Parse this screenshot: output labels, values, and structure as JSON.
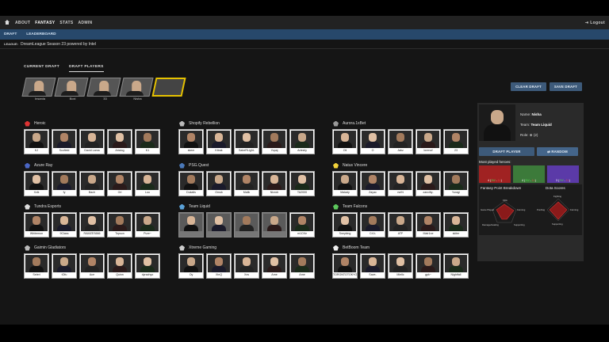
{
  "topnav": {
    "items": [
      "ABOUT",
      "FANTASY",
      "STATS",
      "ADMIN"
    ],
    "active": "FANTASY",
    "logout": "Logout"
  },
  "subnav": {
    "items": [
      "DRAFT",
      "LEADERBOARD"
    ]
  },
  "league": {
    "label": "LEAGUE:",
    "value": "DreamLeague Season 23 powered by Intel"
  },
  "tabs": [
    "CURRENT DRAFT",
    "DRAFT PLAYERS"
  ],
  "draft_slots": [
    "Insania",
    "Boxi",
    "33",
    "Nisha",
    ""
  ],
  "actions": {
    "clear": "CLEAR DRAFT",
    "save": "SAVE DRAFT"
  },
  "teams": [
    {
      "name": "Heroic",
      "color": "#d33",
      "players": [
        "KJ",
        "Scofield",
        "David Lama",
        "Arialog",
        "K1"
      ]
    },
    {
      "name": "Shopify Rebellion",
      "color": "#bbb",
      "players": [
        "skem",
        "Kitrak",
        "SabeRLight-",
        "Yopaj",
        "Artesiiy"
      ]
    },
    {
      "name": "Aurora.1xBet",
      "color": "#999",
      "players": [
        "Oli",
        "O",
        "Jabz",
        "lorenof",
        "23"
      ]
    },
    {
      "name": "Azure Ray",
      "color": "#4a66c4",
      "players": [
        "Xxlk",
        "fy",
        "Bach",
        "Ori",
        "Lou"
      ]
    },
    {
      "name": "PSG.Quest",
      "color": "#4a78b8",
      "players": [
        "Dukalis",
        "Omuk",
        "Malik",
        "Nicrob",
        "TA2000"
      ]
    },
    {
      "name": "Natus Vincere",
      "color": "#f2d33a",
      "players": [
        "Malady",
        "Zayac",
        "rsriN",
        "zanclity-",
        "Yuragi"
      ]
    },
    {
      "name": "Tundra Esports",
      "color": "#ddd",
      "players": [
        "Whitemon",
        "9Class",
        "RAMZES666",
        "Topson",
        "Pure~"
      ]
    },
    {
      "name": "Team Liquid",
      "color": "#5aa1d8",
      "players": [
        "",
        "",
        "",
        "",
        "m1CKe"
      ],
      "dim": [
        0,
        1,
        2,
        3
      ]
    },
    {
      "name": "Team Falcons",
      "color": "#5cc75c",
      "players": [
        "Sneyking",
        "Cr1t-",
        "ATF",
        "Malr1ne",
        "skiter"
      ]
    },
    {
      "name": "Gaimin Gladiators",
      "color": "#bbb",
      "players": [
        "Seleri",
        "tOfu",
        "Ace",
        "Quinn",
        "dyrachyo"
      ]
    },
    {
      "name": "Xtreme Gaming",
      "color": "#ccc",
      "players": [
        "Oy",
        "XinQ",
        "Xxs",
        "Ame",
        "Ame"
      ]
    },
    {
      "name": "BetBoom Team",
      "color": "#eee",
      "players": [
        "TORONTOTOKYO",
        "Save-",
        "Miellc",
        "gpk~",
        "Nightfall"
      ]
    }
  ],
  "panel": {
    "name_label": "Name:",
    "name": "Nisha",
    "team_label": "Team:",
    "team": "Team Liquid",
    "role_label": "Role:",
    "role": "(2)",
    "draft_btn": "DRAFT PLAYER",
    "random_btn": "RANDOM",
    "most_played": "Most played heroes:",
    "heroes": [
      {
        "count": "4",
        "w": "3W",
        "l": "1L",
        "color": "#a02222"
      },
      {
        "count": "4",
        "w": "3W",
        "l": "1L",
        "color": "#3c7a3a"
      },
      {
        "count": "3",
        "w": "2W",
        "l": "1L",
        "color": "#5b3aa8"
      }
    ],
    "fantasy_title": "Fantasy Point Breakdown",
    "dota_title": "Dota Scores",
    "fantasy_labels": [
      "KDA",
      "Farming",
      "Supporting",
      "Damage/Healing",
      "Game Played"
    ],
    "dota_labels": [
      "Fighting",
      "Farming",
      "Supporting",
      "Pushing"
    ]
  }
}
